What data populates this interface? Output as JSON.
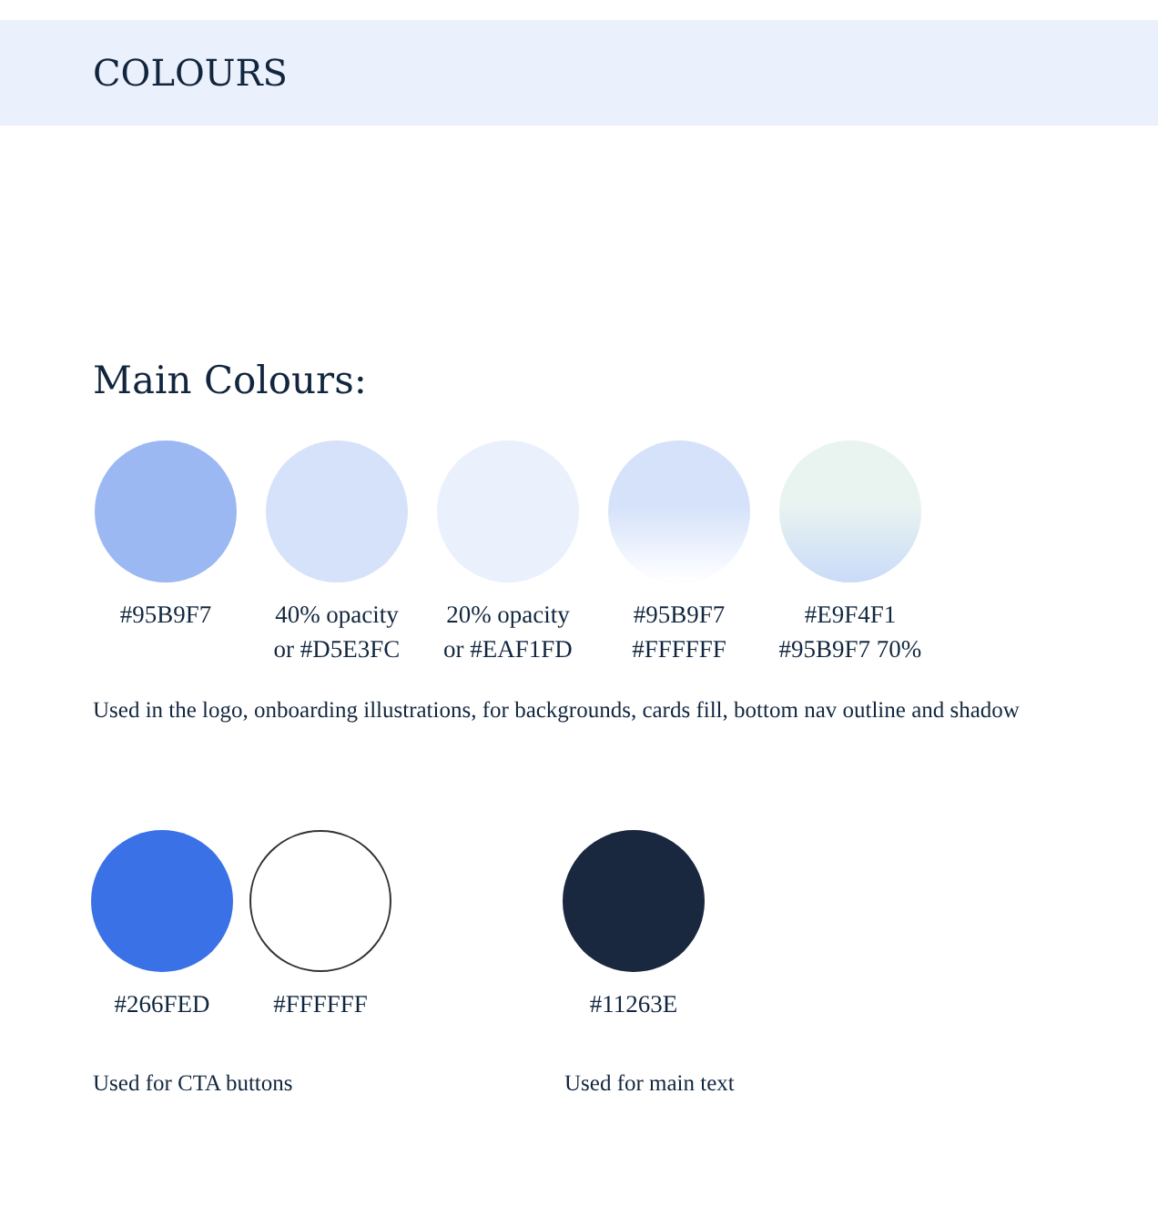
{
  "header": {
    "title": "COLOURS"
  },
  "main": {
    "heading": "Main Colours:",
    "swatches": [
      {
        "kind": "solid",
        "color": "#9cb8f3",
        "label": "#95B9F7"
      },
      {
        "kind": "solid",
        "color": "#d6e2fa",
        "label": "40% opacity\nor #D5E3FC"
      },
      {
        "kind": "solid",
        "color": "#eaf0fc",
        "label": "20% opacity\nor #EAF1FD"
      },
      {
        "kind": "gradient",
        "stops": [
          {
            "color": "#d5e2fa"
          },
          {
            "color": "#ffffff"
          }
        ],
        "label": "#95B9F7\n#FFFFFF"
      },
      {
        "kind": "gradient",
        "stops": [
          {
            "color": "#e9f4f1"
          },
          {
            "color": "#c9daf8"
          }
        ],
        "label": "#E9F4F1\n#95B9F7 70%"
      }
    ],
    "caption": "Used in the logo, onboarding illustrations, for backgrounds, cards fill, bottom nav outline and shadow"
  },
  "groups": [
    {
      "swatches": [
        {
          "kind": "solid",
          "color": "#3b71e6",
          "label": "#266FED"
        },
        {
          "kind": "outline",
          "color": "#ffffff",
          "label": "#FFFFFF"
        }
      ],
      "caption": "Used for CTA buttons"
    },
    {
      "swatches": [
        {
          "kind": "solid",
          "color": "#19273f",
          "label": "#11263E"
        }
      ],
      "caption": "Used for main text"
    }
  ]
}
